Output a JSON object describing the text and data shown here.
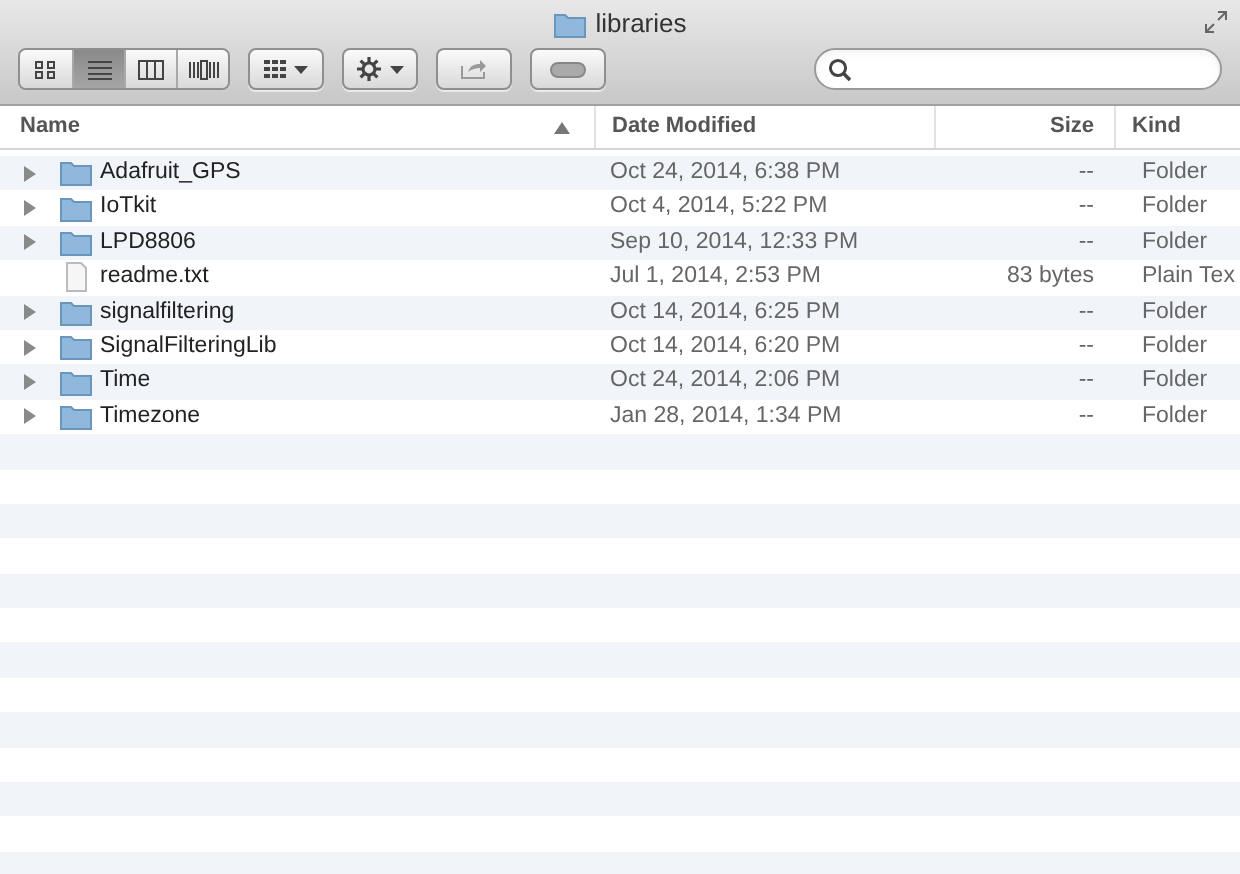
{
  "window": {
    "title": "libraries"
  },
  "view_modes": [
    {
      "kind": "icon",
      "selected": false
    },
    {
      "kind": "list",
      "selected": true
    },
    {
      "kind": "columns",
      "selected": false
    },
    {
      "kind": "coverflow",
      "selected": false
    }
  ],
  "table": {
    "columns": [
      {
        "label": "Name",
        "sorted": true
      },
      {
        "label": "Date Modified",
        "sorted": false
      },
      {
        "label": "Size",
        "sorted": false
      },
      {
        "label": "Kind",
        "sorted": false
      }
    ],
    "rows": [
      {
        "kind": "folder",
        "name": "Adafruit_GPS",
        "date": "Oct 24, 2014, 6:38 PM",
        "size": "--",
        "type": "Folder"
      },
      {
        "kind": "folder",
        "name": "IoTkit",
        "date": "Oct 4, 2014, 5:22 PM",
        "size": "--",
        "type": "Folder"
      },
      {
        "kind": "folder",
        "name": "LPD8806",
        "date": "Sep 10, 2014, 12:33 PM",
        "size": "--",
        "type": "Folder"
      },
      {
        "kind": "file",
        "name": "readme.txt",
        "date": "Jul 1, 2014, 2:53 PM",
        "size": "83 bytes",
        "type": "Plain Tex"
      },
      {
        "kind": "folder",
        "name": "signalfiltering",
        "date": "Oct 14, 2014, 6:25 PM",
        "size": "--",
        "type": "Folder"
      },
      {
        "kind": "folder",
        "name": "SignalFilteringLib",
        "date": "Oct 14, 2014, 6:20 PM",
        "size": "--",
        "type": "Folder"
      },
      {
        "kind": "folder",
        "name": "Time",
        "date": "Oct 24, 2014, 2:06 PM",
        "size": "--",
        "type": "Folder"
      },
      {
        "kind": "folder",
        "name": "Timezone",
        "date": "Jan 28, 2014, 1:34 PM",
        "size": "--",
        "type": "Folder"
      }
    ]
  }
}
